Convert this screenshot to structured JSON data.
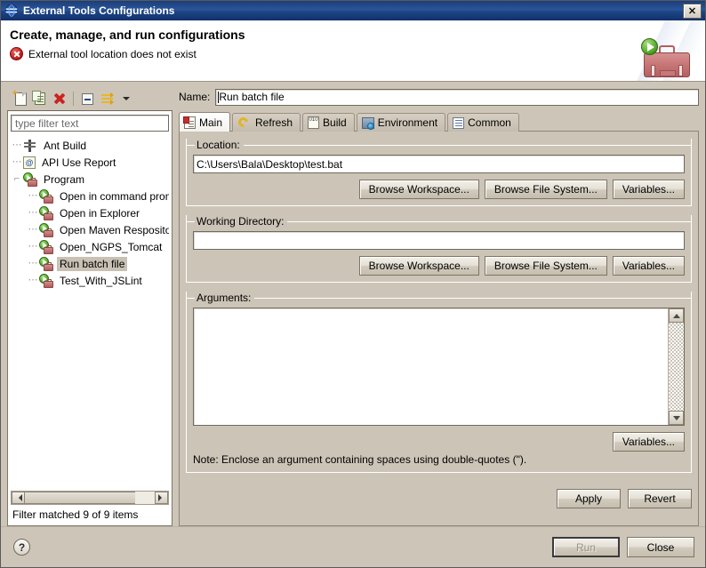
{
  "window": {
    "title": "External Tools Configurations",
    "app_icon": "eclipse-globe-icon",
    "close_label": "✕"
  },
  "header": {
    "title": "Create, manage, and run configurations",
    "message": "External tool location does not exist",
    "message_icon": "error-icon",
    "art_icon": "external-tools-toolbox-icon"
  },
  "toolbar": {
    "items": [
      {
        "name": "new-configuration",
        "icon": "new-document-icon"
      },
      {
        "name": "duplicate-configuration",
        "icon": "copy-icon"
      },
      {
        "name": "delete-configuration",
        "icon": "red-x-delete-icon"
      },
      {
        "name": "collapse-all",
        "icon": "collapse-all-icon"
      },
      {
        "name": "filter-configurations",
        "icon": "filter-arrows-icon"
      },
      {
        "name": "view-menu",
        "icon": "chevron-down-icon"
      }
    ]
  },
  "filter": {
    "placeholder": "type filter text",
    "value": "",
    "status": "Filter matched 9 of 9 items"
  },
  "tree": {
    "items": [
      {
        "label": "Ant Build",
        "icon": "ant-build-icon",
        "level": 0,
        "selected": false
      },
      {
        "label": "API Use Report",
        "icon": "api-use-report-icon",
        "level": 0,
        "selected": false
      },
      {
        "label": "Program",
        "icon": "program-launch-icon",
        "level": 0,
        "selected": false
      },
      {
        "label": "Open in command prompt",
        "icon": "program-launch-icon",
        "level": 1,
        "selected": false
      },
      {
        "label": "Open in Explorer",
        "icon": "program-launch-icon",
        "level": 1,
        "selected": false
      },
      {
        "label": "Open Maven Respository",
        "icon": "program-launch-icon",
        "level": 1,
        "selected": false
      },
      {
        "label": "Open_NGPS_Tomcat",
        "icon": "program-launch-icon",
        "level": 1,
        "selected": false
      },
      {
        "label": "Run batch file",
        "icon": "program-launch-icon",
        "level": 1,
        "selected": true
      },
      {
        "label": "Test_With_JSLint",
        "icon": "program-launch-icon",
        "level": 1,
        "selected": false
      }
    ]
  },
  "config": {
    "name_label": "Name:",
    "name_value": "Run batch file"
  },
  "tabs": [
    {
      "label": "Main",
      "icon": "main-tab-icon",
      "active": true
    },
    {
      "label": "Refresh",
      "icon": "refresh-tab-icon",
      "active": false
    },
    {
      "label": "Build",
      "icon": "build-tab-icon",
      "active": false
    },
    {
      "label": "Environment",
      "icon": "environment-tab-icon",
      "active": false
    },
    {
      "label": "Common",
      "icon": "common-tab-icon",
      "active": false
    }
  ],
  "main_tab": {
    "location": {
      "title": "Location:",
      "value": "C:\\Users\\Bala\\Desktop\\test.bat",
      "browse_workspace": "Browse Workspace...",
      "browse_file_system": "Browse File System...",
      "variables": "Variables..."
    },
    "working_directory": {
      "title": "Working Directory:",
      "value": "",
      "browse_workspace": "Browse Workspace...",
      "browse_file_system": "Browse File System...",
      "variables": "Variables..."
    },
    "arguments": {
      "title": "Arguments:",
      "value": "",
      "variables": "Variables...",
      "note": "Note: Enclose an argument containing spaces using double-quotes (\")."
    }
  },
  "actions": {
    "apply": "Apply",
    "revert": "Revert"
  },
  "footer": {
    "help_icon": "help-question-icon",
    "help_glyph": "?",
    "run": "Run",
    "close": "Close",
    "run_enabled": false
  },
  "colors": {
    "dialog_background": "#cdc5b8",
    "titlebar_blue": "#1d4585",
    "panel_background": "#ccc4b7",
    "field_white": "#ffffff",
    "selection": "#c8c1b4",
    "error_red": "#c21f1f",
    "accent_green": "#54a82c"
  }
}
